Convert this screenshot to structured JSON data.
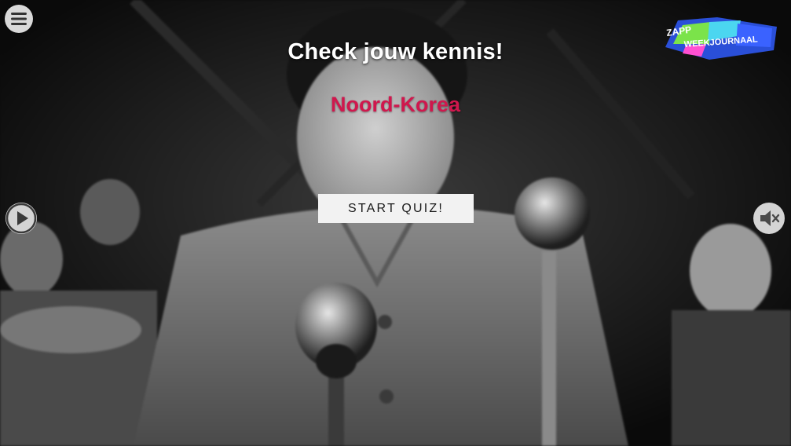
{
  "quiz": {
    "title": "Check jouw kennis!",
    "topic": "Noord-Korea",
    "start_label": "START QUIZ!"
  },
  "logo": {
    "line1": "ZAPP",
    "line2": "WEEKJOURNAAL"
  },
  "icons": {
    "menu": "menu-icon",
    "play": "play-icon",
    "mute": "mute-icon"
  },
  "colors": {
    "topic": "#d0174d",
    "title": "#ffffff",
    "button_bg": "#f2f2f2"
  }
}
